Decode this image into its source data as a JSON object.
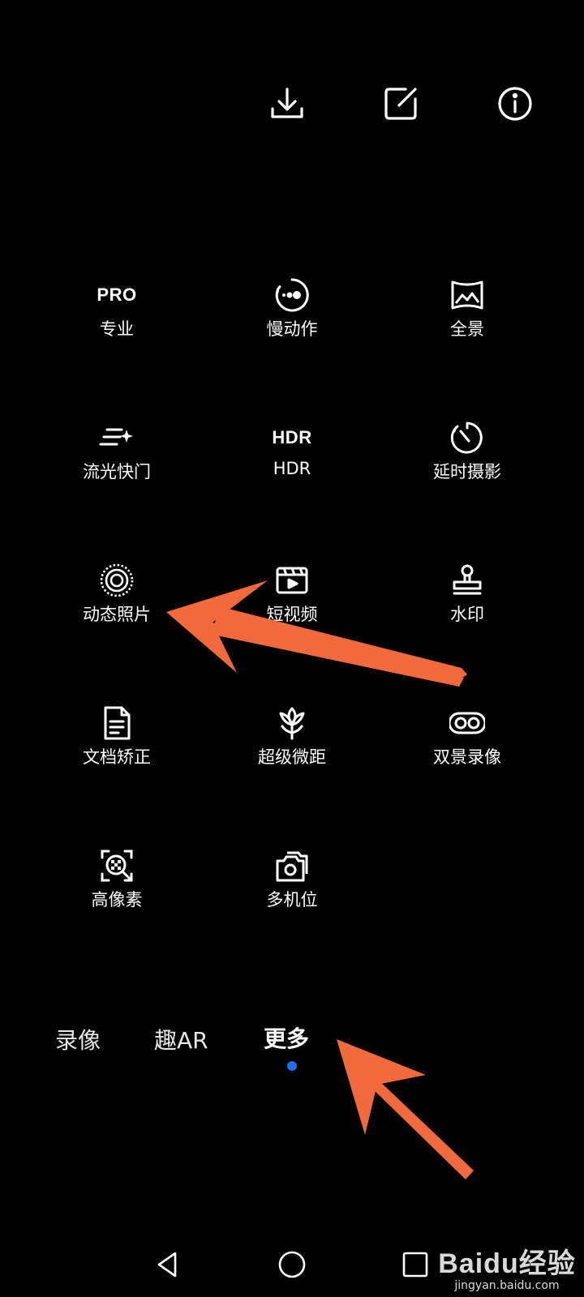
{
  "colors": {
    "background": "#000000",
    "icon": "#ffffff",
    "active_dot": "#1f6cf2",
    "annotation_arrow": "#f26a3c"
  },
  "toolbar": {
    "icons": [
      "download-icon",
      "edit-icon",
      "info-icon"
    ]
  },
  "modes": [
    {
      "icon": "pro-text-icon",
      "glyph_text": "PRO",
      "label": "专业"
    },
    {
      "icon": "slow-motion-icon",
      "label": "慢动作"
    },
    {
      "icon": "panorama-icon",
      "label": "全景"
    },
    {
      "icon": "light-painting-icon",
      "label": "流光快门"
    },
    {
      "icon": "hdr-text-icon",
      "glyph_text": "HDR",
      "label": "HDR"
    },
    {
      "icon": "timelapse-icon",
      "label": "延时摄影"
    },
    {
      "icon": "moving-picture-icon",
      "label": "动态照片"
    },
    {
      "icon": "short-video-icon",
      "label": "短视频"
    },
    {
      "icon": "stamp-icon",
      "label": "水印"
    },
    {
      "icon": "document-icon",
      "label": "文档矫正"
    },
    {
      "icon": "flower-icon",
      "label": "超级微距"
    },
    {
      "icon": "dual-view-icon",
      "label": "双景录像"
    },
    {
      "icon": "high-res-icon",
      "label": "高像素"
    },
    {
      "icon": "multi-camera-icon",
      "label": "多机位"
    }
  ],
  "tabs": [
    {
      "label": "录像",
      "active": false
    },
    {
      "label": "趣AR",
      "active": false
    },
    {
      "label": "更多",
      "active": true
    }
  ],
  "navbar": {
    "icons": [
      "back-icon",
      "home-icon",
      "recents-icon"
    ]
  },
  "watermark": {
    "logo": "Baidu经验",
    "sub": "jingyan.baidu.com"
  }
}
